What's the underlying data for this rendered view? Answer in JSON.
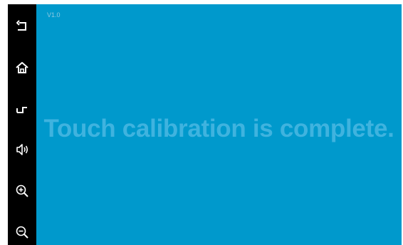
{
  "app": {
    "version_label": "V1.0",
    "message": "Touch calibration is complete."
  },
  "sidebar": {
    "buttons": [
      {
        "icon": "back-icon"
      },
      {
        "icon": "home-icon"
      },
      {
        "icon": "recent-apps-icon"
      },
      {
        "icon": "volume-icon"
      },
      {
        "icon": "zoom-in-icon"
      },
      {
        "icon": "zoom-out-icon"
      }
    ]
  },
  "colors": {
    "background": "#0099CC",
    "message": "#3FB3DF",
    "sidebar": "#000000",
    "icon": "#FFFFFF"
  }
}
